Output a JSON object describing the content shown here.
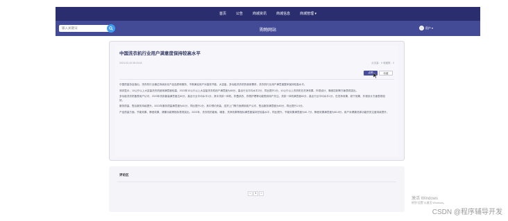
{
  "nav": {
    "items": [
      {
        "label": "首页"
      },
      {
        "label": "公告"
      },
      {
        "label": "商城资讯"
      },
      {
        "label": "商城信息"
      },
      {
        "label": "商城管理 ▾"
      }
    ]
  },
  "header": {
    "search_placeholder": "输入关键词",
    "site_title": "购物网站",
    "user_name": "用户 ▾"
  },
  "article": {
    "title": "中国洗衣机行业用户满意度保持较高水平",
    "meta": "2024-03-15 08:18:18",
    "stats": "点击量：6    收藏数：0",
    "like_label": "点赞",
    "fav_label": "收藏",
    "paragraphs": [
      "中国质量协会指出，洗衣机行业通过持续优化产品品质和服务，不断满足用户对高效节能、大容量、多功能洗衣机的使用需求，洗衣机行业用户满意度整体保持较高水平。",
      "测评显示，10公斤以上大容量洗衣机使用满意度较高，2023年10公斤以上大容量洗衣机用户满意度为80分，高出行业平均水平2分，同比提升1分，10公斤以上洗衣机在洗净效果、外观设计、噪音控制等方面表现突出。",
      "多功能洗衣机备受用户认可，2023年洗烘套装满意度达80分，高出行业平均水平1分，其中洗烘一体机、折叠烘衣、衣物护理等功能受到用户关注。洗烘一体机满意度80分，高出行业平均水平1分，在洗净效果、烘干效果、外观设计方面表现较好。",
      "服务质量、售后服务持续提升。2023年服务质量满意度为81分，同比提升1分，其中预约安装、送货上门等方面得到用户认可，售后服务满意度为80分，同比提升1.5分。",
      "产品质量方面，节能效果、静音效果、健康功能等指标表现突出。2023年，洗衣机的能耗、噪音、洗净效果等指标满意度保持在较高水平，同比提升。节能效果满意度为81.7分，静音效果满意度为80.8分，用户对健康洗涤功能的关注度持续提升。"
    ]
  },
  "comments": {
    "label": "评论区",
    "pager": [
      "<",
      "1",
      ">"
    ]
  },
  "watermark": {
    "line1": "激活 Windows",
    "line2": "转到\"设置\"以激活 Windows。"
  },
  "csdn": "CSDN @程序辅导开发"
}
